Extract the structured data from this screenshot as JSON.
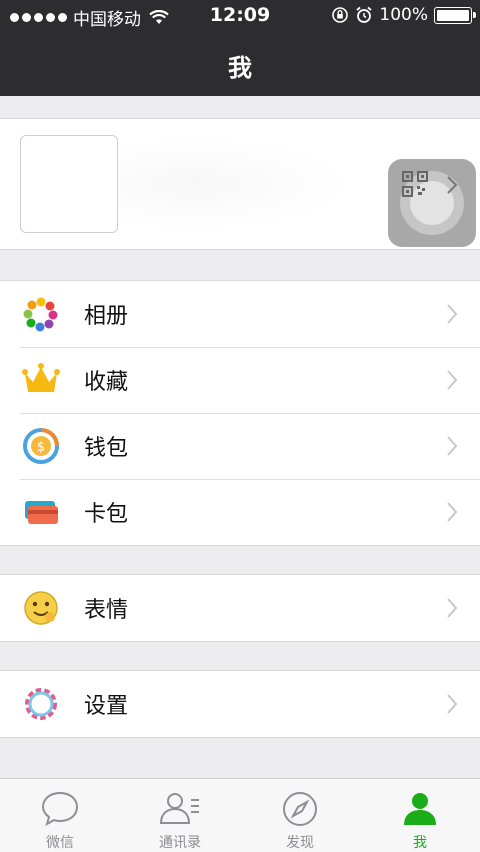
{
  "status_bar": {
    "carrier": "中国移动",
    "time": "12:09",
    "battery": "100%",
    "battery_level": 1.0,
    "icons": [
      "wifi-icon",
      "orientation-lock-icon",
      "alarm-icon",
      "battery-icon"
    ]
  },
  "nav": {
    "title": "我"
  },
  "profile": {
    "qr_icon": "qr-code-icon"
  },
  "groups": {
    "g1": [
      {
        "label": "相册",
        "icon": "album-icon"
      },
      {
        "label": "收藏",
        "icon": "crown-icon"
      },
      {
        "label": "钱包",
        "icon": "wallet-icon"
      },
      {
        "label": "卡包",
        "icon": "card-icon"
      }
    ],
    "g2": [
      {
        "label": "表情",
        "icon": "emoji-icon"
      }
    ],
    "g3": [
      {
        "label": "设置",
        "icon": "settings-gear-icon"
      }
    ]
  },
  "tabs": [
    {
      "label": "微信",
      "icon": "chat-bubble-icon",
      "active": false
    },
    {
      "label": "通讯录",
      "icon": "contacts-icon",
      "active": false
    },
    {
      "label": "发现",
      "icon": "compass-icon",
      "active": false
    },
    {
      "label": "我",
      "icon": "person-icon",
      "active": true
    }
  ],
  "colors": {
    "bar_dark": "#2d2d2f",
    "accent_green": "#1aad19",
    "background": "#ededf0"
  }
}
